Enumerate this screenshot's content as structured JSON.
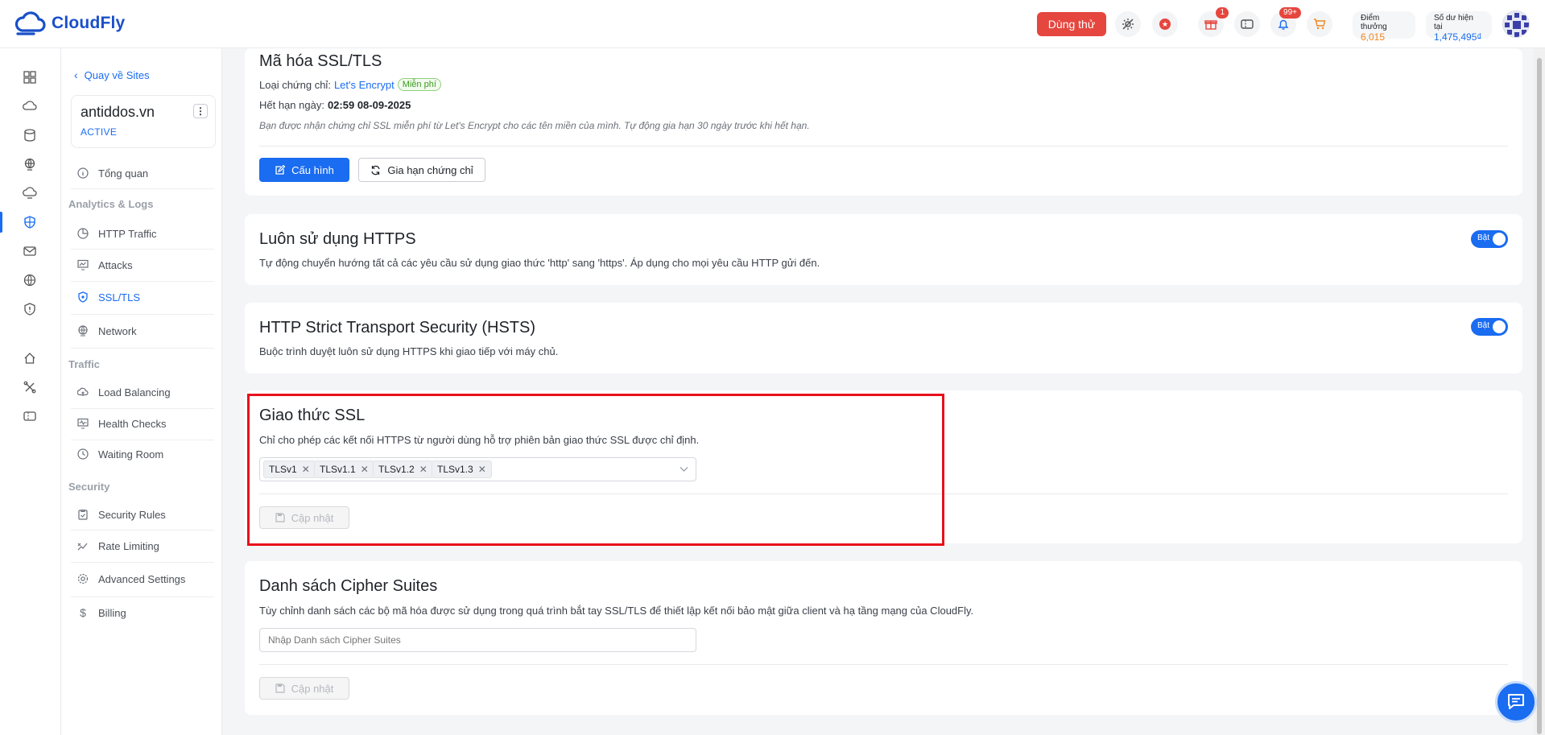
{
  "header": {
    "logo_text": "CloudFly",
    "trial_label": "Dùng thử",
    "gift_badge": "1",
    "notif_badge": "99+",
    "points_label": "Điểm thưởng",
    "points_value": "6,015",
    "balance_label": "Số dư hiện tại",
    "balance_value": "1,475,495₫"
  },
  "sidebar": {
    "back_label": "Quay về Sites",
    "site_name": "antiddos.vn",
    "site_status": "ACTIVE",
    "overview": "Tổng quan",
    "group_analytics": "Analytics & Logs",
    "http_traffic": "HTTP Traffic",
    "attacks": "Attacks",
    "ssl_tls": "SSL/TLS",
    "network": "Network",
    "group_traffic": "Traffic",
    "load_balancing": "Load Balancing",
    "health_checks": "Health Checks",
    "waiting_room": "Waiting Room",
    "group_security": "Security",
    "security_rules": "Security Rules",
    "rate_limiting": "Rate Limiting",
    "advanced_settings": "Advanced Settings",
    "billing": "Billing"
  },
  "ssl_card": {
    "title": "Mã hóa SSL/TLS",
    "cert_type_label": "Loại chứng chỉ:",
    "cert_type_value": "Let's Encrypt",
    "free_badge": "Miễn phí",
    "expiry_label": "Hết hạn ngày:",
    "expiry_value": "02:59 08-09-2025",
    "note": "Bạn được nhận chứng chỉ SSL miễn phí từ Let's Encrypt cho các tên miền của mình. Tự động gia hạn 30 ngày trước khi hết hạn.",
    "configure_label": "Cấu hình",
    "renew_label": "Gia hạn chứng chỉ"
  },
  "https_card": {
    "title": "Luôn sử dụng HTTPS",
    "desc": "Tự động chuyển hướng tất cả các yêu cầu sử dụng giao thức 'http' sang 'https'. Áp dụng cho mọi yêu cầu HTTP gửi đến.",
    "toggle_label": "Bật",
    "enabled": true
  },
  "hsts_card": {
    "title": "HTTP Strict Transport Security (HSTS)",
    "desc": "Buộc trình duyệt luôn sử dụng HTTPS khi giao tiếp với máy chủ.",
    "toggle_label": "Bật",
    "enabled": true
  },
  "protocol_card": {
    "title": "Giao thức SSL",
    "desc": "Chỉ cho phép các kết nối HTTPS từ người dùng hỗ trợ phiên bản giao thức SSL được chỉ định.",
    "tags": [
      "TLSv1",
      "TLSv1.1",
      "TLSv1.2",
      "TLSv1.3"
    ],
    "update_label": "Cập nhật"
  },
  "cipher_card": {
    "title": "Danh sách Cipher Suites",
    "desc": "Tùy chỉnh danh sách các bộ mã hóa được sử dụng trong quá trình bắt tay SSL/TLS để thiết lập kết nối bảo mật giữa client và hạ tầng mạng của CloudFly.",
    "placeholder": "Nhập Danh sách Cipher Suites",
    "update_label": "Cập nhật"
  },
  "colors": {
    "primary": "#1a6cf0",
    "danger": "#e5463e",
    "highlight": "#e8101a",
    "points": "#f0861e"
  }
}
